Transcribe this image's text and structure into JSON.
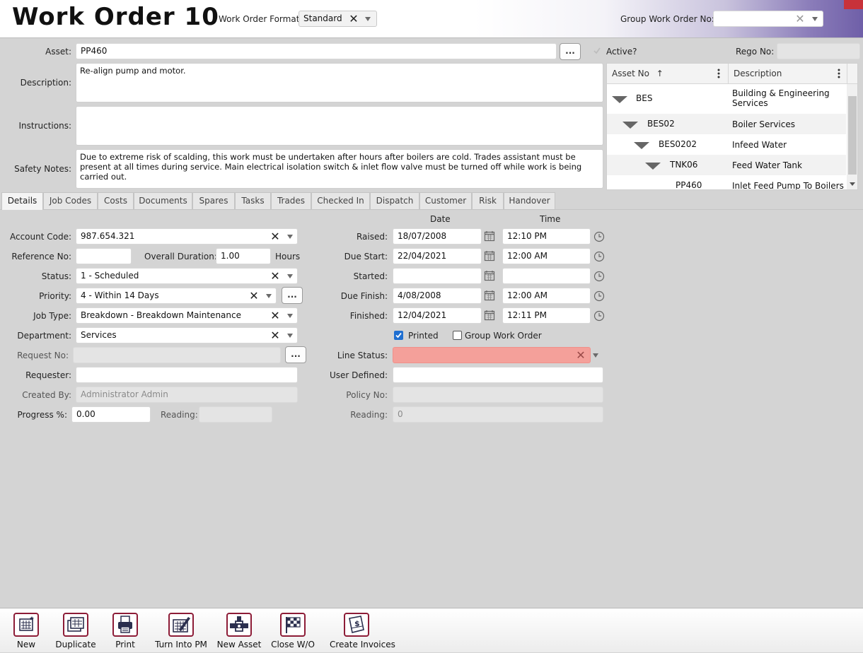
{
  "header": {
    "title": "Work Order 10",
    "format_label": "Work Order Format",
    "format_value": "Standard",
    "group_wo_label": "Group Work Order No:",
    "group_wo_value": ""
  },
  "top": {
    "asset_label": "Asset:",
    "asset_value": "PP460",
    "active_label": "Active?",
    "rego_label": "Rego No:",
    "rego_value": "",
    "description_label": "Description:",
    "description_value": "Re-align pump and motor.",
    "instructions_label": "Instructions:",
    "instructions_value": "",
    "safety_label": "Safety Notes:",
    "safety_value": "Due to extreme risk of scalding, this work must be undertaken after hours after boilers are cold.  Trades assistant must be present at all times during service.  Main electrical isolation switch & inlet flow valve must be turned off while work is being carried out."
  },
  "asset_grid": {
    "columns": [
      "Asset No",
      "Description"
    ],
    "rows": [
      {
        "asset_no": "BES",
        "description": "Building & Engineering Services"
      },
      {
        "asset_no": "BES02",
        "description": "Boiler Services"
      },
      {
        "asset_no": "BES0202",
        "description": "Infeed Water"
      },
      {
        "asset_no": "TNK06",
        "description": "Feed Water Tank"
      },
      {
        "asset_no": "PP460",
        "description": "Inlet Feed Pump To Boilers"
      }
    ]
  },
  "tabs": [
    "Details",
    "Job Codes",
    "Costs",
    "Documents",
    "Spares",
    "Tasks",
    "Trades",
    "Checked In",
    "Dispatch",
    "Customer",
    "Risk",
    "Handover"
  ],
  "details": {
    "account_code_label": "Account Code:",
    "account_code": "987.654.321",
    "reference_no_label": "Reference No:",
    "reference_no": "",
    "overall_duration_label": "Overall Duration:",
    "overall_duration": "1.00",
    "hours_label": "Hours",
    "status_label": "Status:",
    "status": "1 - Scheduled",
    "priority_label": "Priority:",
    "priority": "4 - Within 14 Days",
    "job_type_label": "Job Type:",
    "job_type": "Breakdown - Breakdown Maintenance",
    "department_label": "Department:",
    "department": "Services",
    "request_no_label": "Request No:",
    "request_no": "",
    "requester_label": "Requester:",
    "requester": "",
    "created_by_label": "Created By:",
    "created_by": "Administrator Admin",
    "progress_label": "Progress %:",
    "progress": "0.00",
    "reading_label": "Reading:",
    "reading": ""
  },
  "dates": {
    "date_header": "Date",
    "time_header": "Time",
    "raised_label": "Raised:",
    "raised_date": "18/07/2008",
    "raised_time": "12:10 PM",
    "due_start_label": "Due Start:",
    "due_start_date": "22/04/2021",
    "due_start_time": "12:00 AM",
    "started_label": "Started:",
    "started_date": "",
    "started_time": "",
    "due_finish_label": "Due Finish:",
    "due_finish_date": "4/08/2008",
    "due_finish_time": "12:00 AM",
    "finished_label": "Finished:",
    "finished_date": "12/04/2021",
    "finished_time": "12:11 PM",
    "printed_label": "Printed",
    "printed_checked": true,
    "group_wo_label": "Group Work Order",
    "group_wo_checked": false,
    "line_status_label": "Line Status:",
    "line_status": "",
    "line_status_color": "#f4a09a",
    "user_defined_label": "User Defined:",
    "user_defined": "",
    "policy_no_label": "Policy No:",
    "policy_no": "",
    "reading_label": "Reading:",
    "reading": "0"
  },
  "toolbar": {
    "new": "New",
    "duplicate": "Duplicate",
    "print": "Print",
    "turn_into_pm": "Turn Into PM",
    "new_asset": "New Asset",
    "close_wo": "Close W/O",
    "create_invoices": "Create Invoices",
    "accent_color": "#8d1c37"
  }
}
